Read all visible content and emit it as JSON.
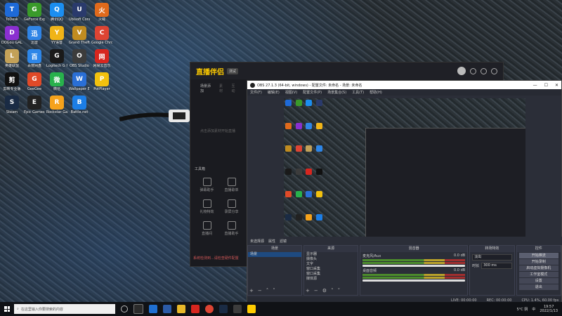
{
  "desktop": {
    "icons": [
      {
        "label": "ToDesk",
        "color": "#1e6ad8",
        "glyph": "T"
      },
      {
        "label": "GeForce Experience",
        "color": "#3a9a2a",
        "glyph": "G"
      },
      {
        "label": "腾讯QQ",
        "color": "#1b8ef0",
        "glyph": "Q"
      },
      {
        "label": "Ubisoft Connect",
        "color": "#2a3a6c",
        "glyph": "U"
      },
      {
        "label": "火绒",
        "color": "#e06a1c",
        "glyph": "火"
      },
      {
        "label": "DOGou GALAXY",
        "color": "#8a2fd0",
        "glyph": "D"
      },
      {
        "label": "迅雷",
        "color": "#2f84e6",
        "glyph": "迅"
      },
      {
        "label": "YY语音",
        "color": "#f0b418",
        "glyph": "Y"
      },
      {
        "label": "Grand Theft Auto V",
        "color": "#c08c20",
        "glyph": "V"
      },
      {
        "label": "Google Chrome",
        "color": "#dd4433",
        "glyph": "C"
      },
      {
        "label": "英雄联盟",
        "color": "#c3a158",
        "glyph": "L"
      },
      {
        "label": "百度网盘",
        "color": "#2d86e8",
        "glyph": "百"
      },
      {
        "label": "Logitech G HUB",
        "color": "#1a1a1a",
        "glyph": "G"
      },
      {
        "label": "OBS Studio",
        "color": "#3c3c3c",
        "glyph": "O"
      },
      {
        "label": "网易云音乐",
        "color": "#d7261f",
        "glyph": "网"
      },
      {
        "label": "剪映专业版",
        "color": "#111111",
        "glyph": "剪"
      },
      {
        "label": "GeeGee",
        "color": "#e04a28",
        "glyph": "G"
      },
      {
        "label": "微信",
        "color": "#28b14c",
        "glyph": "微"
      },
      {
        "label": "Wallpaper Engine",
        "color": "#2a6fd6",
        "glyph": "W"
      },
      {
        "label": "PotPlayer",
        "color": "#f2c10e",
        "glyph": "P"
      },
      {
        "label": "Steam",
        "color": "#1a2b44",
        "glyph": "S"
      },
      {
        "label": "Epic Games Launcher",
        "color": "#222222",
        "glyph": "E"
      },
      {
        "label": "Rockstar Games",
        "color": "#f5a21b",
        "glyph": "R"
      },
      {
        "label": "Battle.net",
        "color": "#1c7ee6",
        "glyph": "B"
      }
    ]
  },
  "assistant": {
    "logo": "直播伴侣",
    "version": "测试",
    "tabs": [
      "场景添加",
      "素材",
      "互动"
    ],
    "hint": "点击添加素材开始直播",
    "tools_title": "工具箱",
    "tools": [
      "弹幕助手",
      "直播歌单",
      "礼物特效",
      "录屏分享",
      "直播间",
      "直播助手"
    ],
    "alert": "系统检测到...请检查硬件配置"
  },
  "obs": {
    "title": "OBS 27.1.3 (64-bit, windows) - 配置文件: 未命名 - 场景: 未命名",
    "menu": [
      "文件(F)",
      "编辑(E)",
      "视图(V)",
      "配置文件(P)",
      "场景集合(S)",
      "工具(T)",
      "帮助(H)"
    ],
    "win_controls": [
      "—",
      "☐",
      "✕"
    ],
    "scene_bar": {
      "label": "未选择源",
      "props": "属性",
      "filters": "滤镜"
    },
    "docks": {
      "scenes": {
        "title": "场景",
        "items": [
          "场景"
        ]
      },
      "sources": {
        "title": "来源",
        "items": [
          "显示器",
          "摄像头",
          "文字",
          "窗口采集",
          "窗口采集",
          "媒体源"
        ]
      },
      "mixer": {
        "title": "混音器",
        "channels": [
          {
            "name": "麦克风/Aux",
            "db": "0.0 dB"
          },
          {
            "name": "桌面音频",
            "db": "0.0 dB"
          }
        ]
      },
      "transitions": {
        "title": "转场特效",
        "type": "淡出",
        "duration_label": "时长",
        "duration": "300 ms"
      },
      "controls": {
        "title": "控件",
        "buttons": [
          "开始推流",
          "开始录制",
          "启动虚拟摄像机",
          "工作室模式",
          "设置",
          "退出"
        ]
      }
    },
    "status": {
      "live": "LIVE: 00:00:00",
      "rec": "REC: 00:00:00",
      "cpu": "CPU: 1.4%, 60.00 fps"
    }
  },
  "taskbar": {
    "search_placeholder": "在这里输入你要搜索的内容",
    "weather": "5°C 阴",
    "lang": "中",
    "time": "19:57",
    "date": "2022/1/13"
  }
}
